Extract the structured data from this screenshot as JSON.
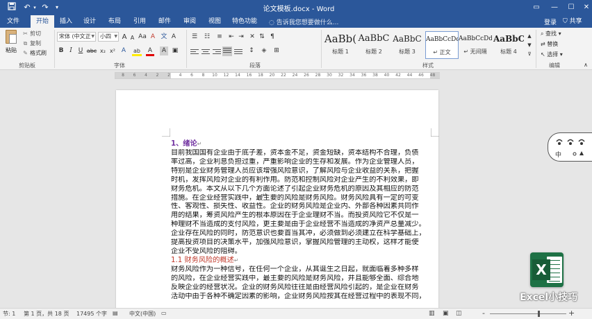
{
  "titlebar": {
    "doc_title": "论文模板.docx - Word",
    "save_icon": "save-icon",
    "undo_icon": "undo-icon",
    "redo_icon": "redo-icon",
    "customize_icon": "customize-qat-icon"
  },
  "tabs": [
    {
      "label": "文件"
    },
    {
      "label": "开始"
    },
    {
      "label": "插入"
    },
    {
      "label": "设计"
    },
    {
      "label": "布局"
    },
    {
      "label": "引用"
    },
    {
      "label": "邮件"
    },
    {
      "label": "审阅"
    },
    {
      "label": "视图"
    },
    {
      "label": "特色功能"
    }
  ],
  "active_tab": "开始",
  "tell_me": "告诉我您想要做什么...",
  "account": {
    "login": "登录",
    "share": "共享"
  },
  "ribbon": {
    "clipboard": {
      "group": "剪贴板",
      "paste": "粘贴",
      "cut": "剪切",
      "copy": "复制",
      "format_painter": "格式刷"
    },
    "font": {
      "group": "字体",
      "font_name": "宋体 (中文正",
      "font_size": "小四",
      "grow": "A",
      "shrink": "A",
      "case": "Aa",
      "clear": "A",
      "bold": "B",
      "italic": "I",
      "underline": "U",
      "strike": "abc",
      "sub": "x₂",
      "sup": "x²",
      "effects": "A",
      "highlight": "ab",
      "color": "A",
      "shade": "A"
    },
    "paragraph": {
      "group": "段落"
    },
    "styles": {
      "group": "样式",
      "items": [
        {
          "sample": "AaBb(",
          "name": "标题 1"
        },
        {
          "sample": "AaBbC",
          "name": "标题 2"
        },
        {
          "sample": "AaBbC",
          "name": "标题 3"
        },
        {
          "sample": "AaBbCcDd",
          "name": "↵ 正文",
          "selected": true
        },
        {
          "sample": "AaBbCcDd",
          "name": "↵ 无间隔"
        },
        {
          "sample": "AaBbC",
          "name": "标题 4"
        }
      ]
    },
    "editing": {
      "group": "编辑",
      "find": "查找",
      "replace": "替换",
      "select": "选择"
    }
  },
  "ruler": {
    "numbers": [
      "8",
      "6",
      "4",
      "2",
      "2",
      "4",
      "6",
      "8",
      "10",
      "12",
      "14",
      "16",
      "18",
      "20",
      "22",
      "24",
      "26",
      "28",
      "30",
      "32",
      "34",
      "36",
      "38",
      "40",
      "42",
      "44",
      "46",
      "48"
    ]
  },
  "document": {
    "heading1": "1、绪论",
    "para1": [
      "目前我国国有企业由于底子差，资本金不足，资金短缺，资本结构不合理，负债",
      "率过高，企业利息负担过重，严重影响企业的生存和发展。作为企业管理人员，",
      "特别是企业财务管理人员应该增强风险意识，了解风险与企业收益的关系，把握",
      "时机，发挥风险对企业的有利作用。防范和控制风险对企业产生的不利效果，即",
      "财务危机。本文从以下几个方面论述了引起企业财务危机的原因及其相应的防范",
      "措施。在企业经营实践中，最主要的风险是财务风险。财务风险具有一定的可变",
      "性、客观性、损失性、收益性。企业的财务风险是企业内、外部各种因素共同作",
      "用的结果，筹资风险产生的根本原因在于企业理财不当。而投资风险它不仅是一",
      "种理财不当造成的支付风险，更主要是由于企业经营不当造成的净资产总量减少。",
      "企业存在风险的同时，防范意识也要首当其冲，必须做到必须建立在科学基础上，",
      "提高投资项目的决策水平，加强风险意识，掌握风险管理的主动权，这样才能使",
      "企业不受风险的阻碍。"
    ],
    "heading2": "1.1 财务风险的概述",
    "para2": [
      "财务风险作为一种信号，在任何一个企业，从其诞生之日起，就面临着多种多样",
      "的风险，在企业经营实践中，最主要的风险是财务风险，并且能够全面、综合地",
      "反映企业的经营状况。企业的财务风险往往是由经营风险引起的，是企业在财务",
      "活动中由于各种不确定因素的影响，企业财务风险按其在经营过程中的表现不同，"
    ]
  },
  "statusbar": {
    "section": "节: 1",
    "page": "第 1 页，共 18 页",
    "words": "17495 个字",
    "proofing_icon": "proofing-icon",
    "language": "中文(中国)",
    "zoom_minus": "-",
    "zoom_plus": "+"
  },
  "overlay": {
    "ime_char": "中",
    "brand": "Excel小技巧",
    "logo_letter": "X"
  }
}
